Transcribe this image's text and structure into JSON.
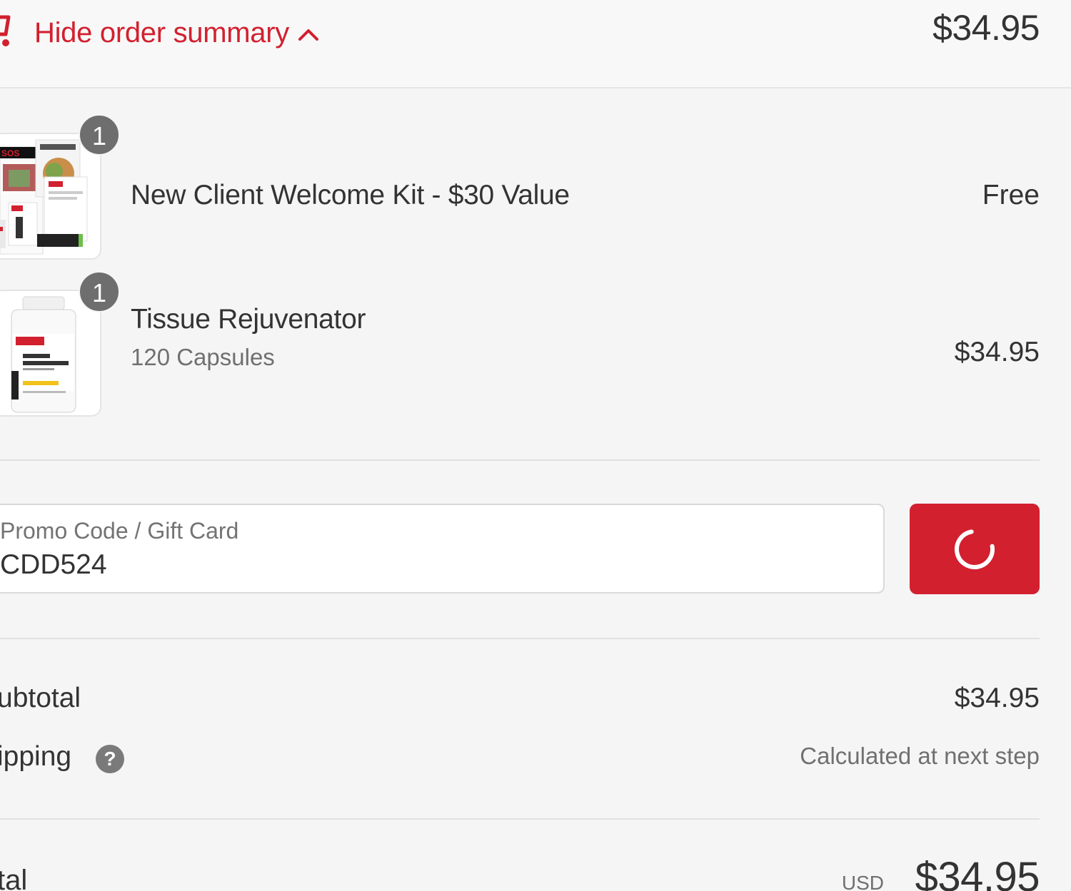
{
  "header": {
    "toggle_label": "Hide order summary",
    "total": "$34.95"
  },
  "items": [
    {
      "quantity": "1",
      "name": "New Client Welcome Kit - $30 Value",
      "variant": "",
      "price": "Free"
    },
    {
      "quantity": "1",
      "name": "Tissue Rejuvenator",
      "variant": "120 Capsules",
      "price": "$34.95"
    }
  ],
  "promo": {
    "placeholder": "Promo Code / Gift Card",
    "value": "CDD524",
    "button_state": "loading"
  },
  "totals": {
    "subtotal_label": "ubtotal",
    "subtotal_value": "$34.95",
    "shipping_label": "ipping",
    "shipping_value": "Calculated at next step",
    "total_label": "tal",
    "currency": "USD",
    "total_value": "$34.95"
  },
  "colors": {
    "accent": "#d2202f",
    "background": "#f5f5f5",
    "text": "#333333",
    "muted": "#707070"
  },
  "icons": {
    "cart": "shopping-cart-icon",
    "chevron": "chevron-up-icon",
    "spinner": "loading-spinner-icon",
    "help": "question-circle-icon"
  }
}
